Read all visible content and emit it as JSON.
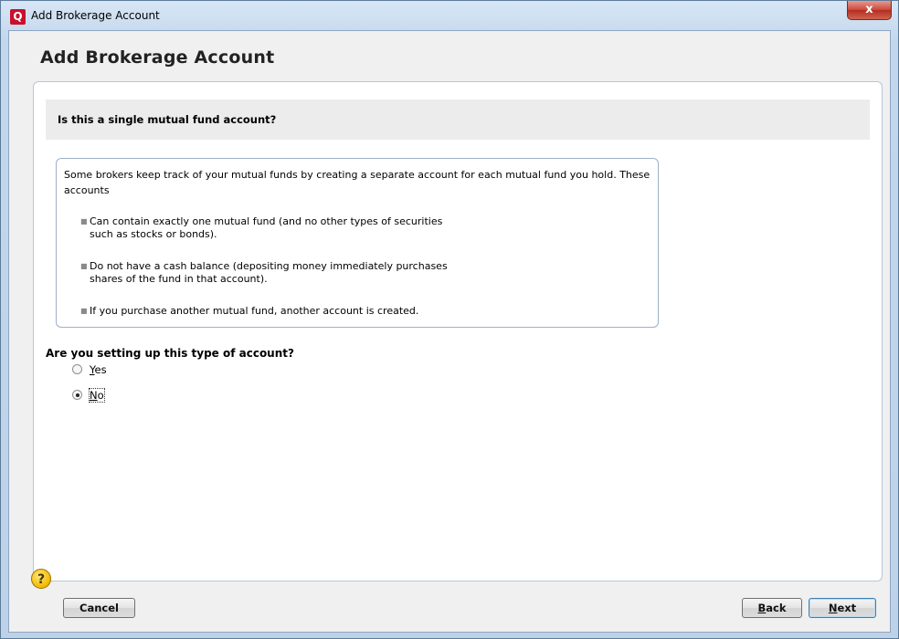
{
  "window": {
    "title": "Add Brokerage Account",
    "close_label": "x"
  },
  "page": {
    "title": "Add Brokerage Account"
  },
  "question": {
    "text": "Is this a single mutual fund account?"
  },
  "info": {
    "intro": "Some brokers keep track of your mutual funds by creating a separate account for each mutual fund you hold. These accounts",
    "bullets": [
      {
        "line1": "Can contain exactly one mutual fund (and no other types of securities",
        "line2": "such as stocks or bonds)."
      },
      {
        "line1": "Do not have a cash balance (depositing money immediately purchases",
        "line2": "shares of the fund in that account)."
      },
      {
        "line1": "If you purchase another mutual fund, another account is created.",
        "line2": ""
      }
    ]
  },
  "setup": {
    "question": "Are you setting up this type of account?",
    "options": [
      {
        "key": "Y",
        "rest": "es",
        "selected": false
      },
      {
        "key": "N",
        "rest": "o",
        "selected": true
      }
    ]
  },
  "footer": {
    "help_label": "?",
    "cancel_label": "Cancel",
    "back_key": "B",
    "back_rest": "ack",
    "next_key": "N",
    "next_rest": "ext"
  }
}
